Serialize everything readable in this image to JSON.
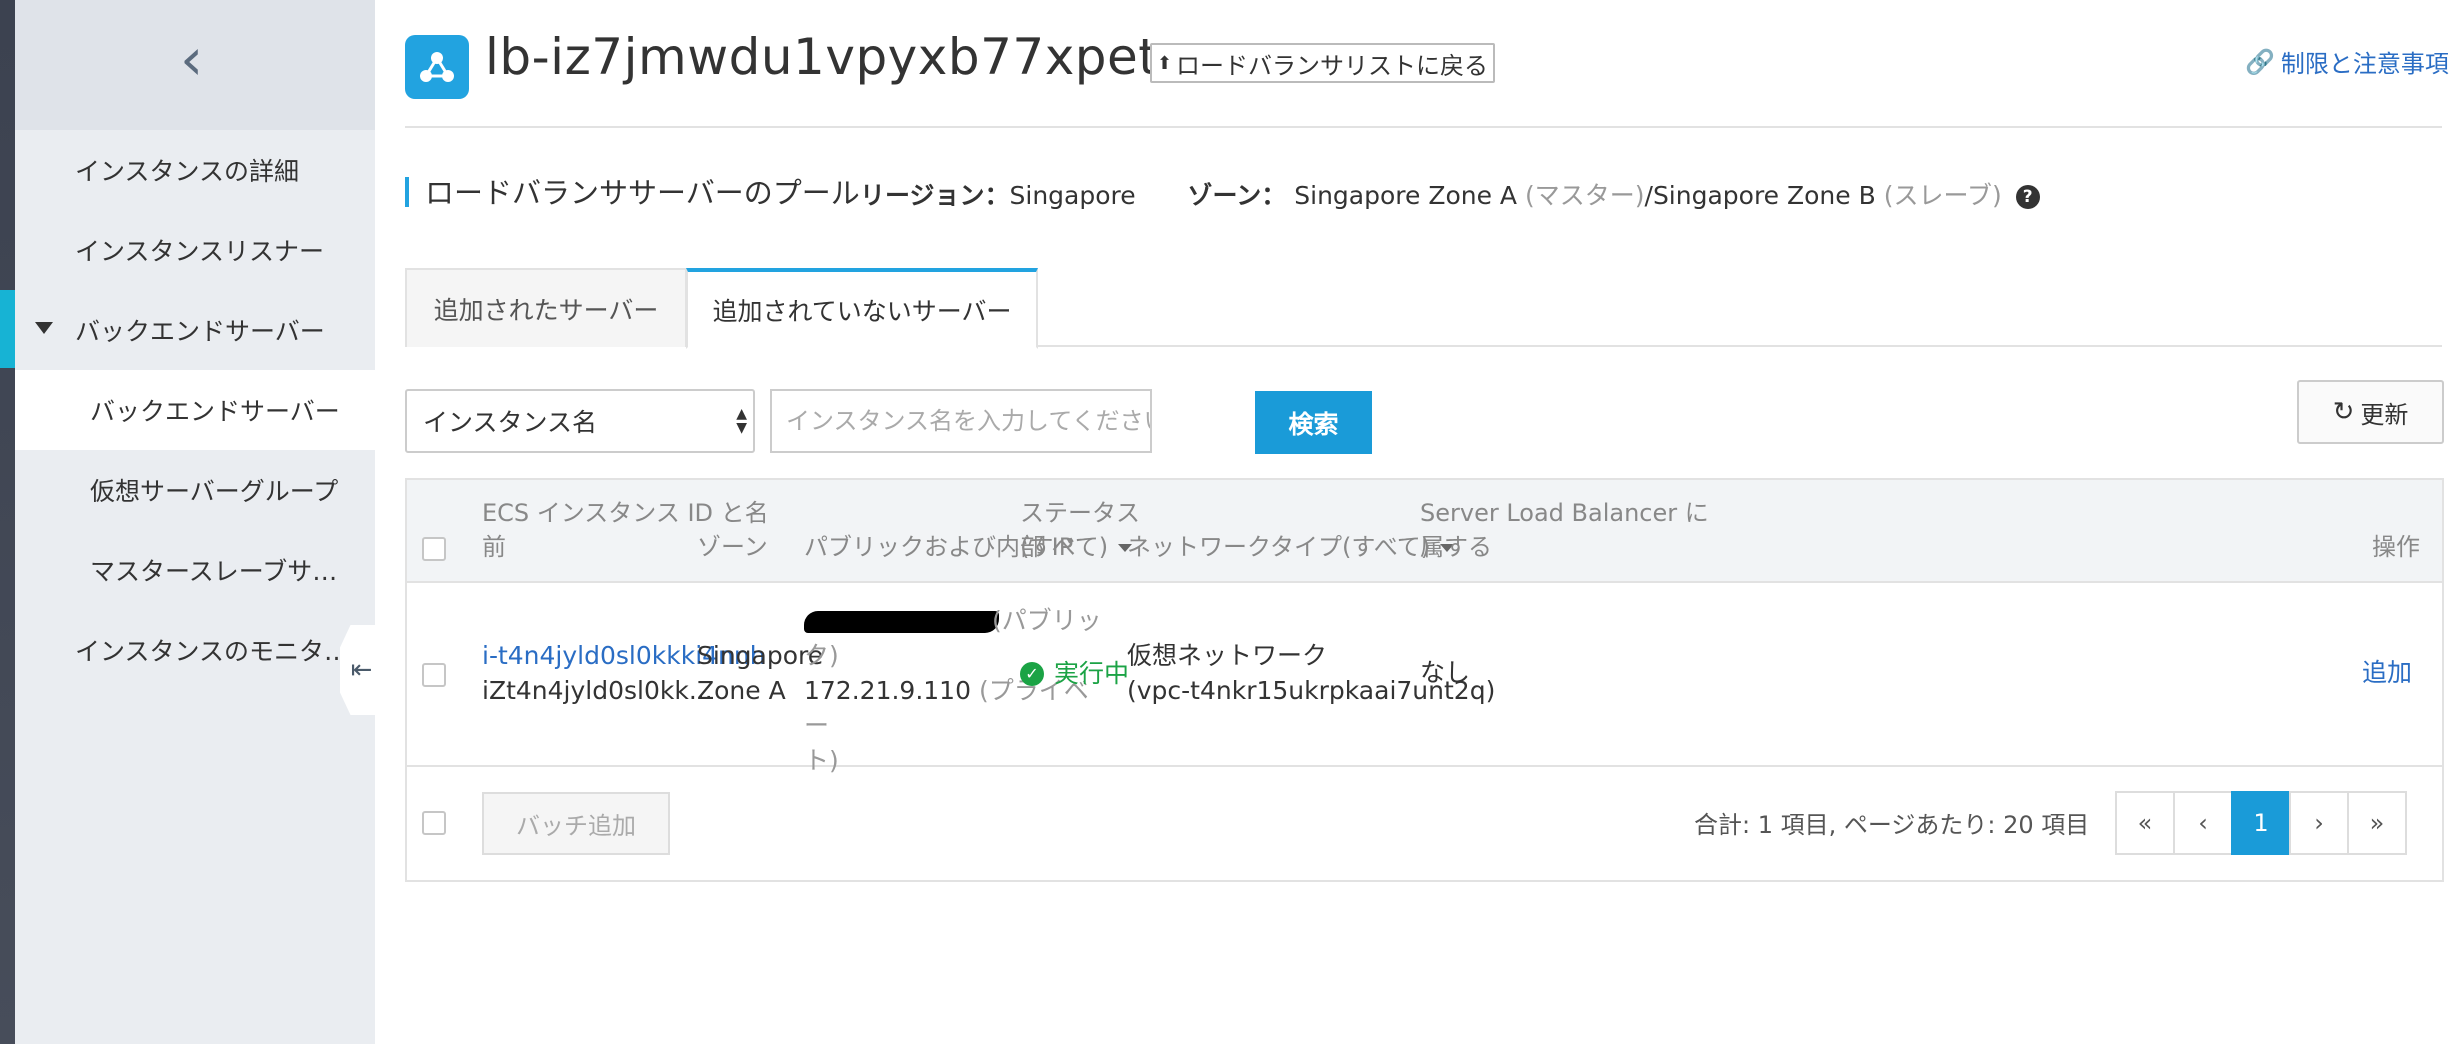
{
  "sidebar": {
    "items": [
      {
        "label": "インスタンスの詳細"
      },
      {
        "label": "インスタンスリスナー"
      },
      {
        "label": "バックエンドサーバー"
      },
      {
        "label": "バックエンドサーバー"
      },
      {
        "label": "仮想サーバーグループ"
      },
      {
        "label": "マスタースレーブサ…"
      },
      {
        "label": "インスタンスのモニタ…"
      }
    ]
  },
  "header": {
    "title": "lb-iz7jmwdu1vpyxb77xpetc",
    "back_label": "ロードバランサリストに戻る",
    "limits_label": "制限と注意事項"
  },
  "section": {
    "title": "ロードバランササーバーのプール",
    "region_label": "リージョン：",
    "region_value": "Singapore",
    "zone_label": "ゾーン：",
    "zone_a": "Singapore Zone A",
    "zone_a_role": "(マスター)",
    "zone_b": "/Singapore Zone B",
    "zone_b_role": "(スレーブ)"
  },
  "tabs": [
    {
      "label": "追加されたサーバー"
    },
    {
      "label": "追加されていないサーバー"
    }
  ],
  "filter": {
    "select_value": "インスタンス名",
    "search_placeholder": "インスタンス名を入力してください",
    "search_button": "検索",
    "refresh_button": "更新"
  },
  "table": {
    "headers": {
      "id": [
        "ECS インスタンス ID と名",
        "前"
      ],
      "zone": "ゾーン",
      "ip": "パブリックおよび内部 IP",
      "status": [
        "ステータス",
        "(すべて)"
      ],
      "network": "ネットワークタイプ(すべて)",
      "slb": [
        "Server Load Balancer に",
        "属する"
      ],
      "action": "操作"
    },
    "rows": [
      {
        "id": "i-t4n4jyld0sl0kkki4nnh",
        "name": "iZt4n4jyld0sl0kk...",
        "zone": [
          "Singapore",
          "Zone A"
        ],
        "public_tag": "(パブリッ",
        "public_tag2": "ク)",
        "private_ip": "172.21.9.110",
        "private_tag": "(プライベー",
        "private_tag2": "ト)",
        "status": "実行中",
        "network": "仮想ネットワーク",
        "vpc": "(vpc-t4nkr15ukrpkaai7unt2q)",
        "slb": "なし",
        "action": "追加"
      }
    ]
  },
  "footer": {
    "batch_add": "バッチ追加",
    "total": "合計: 1 項目, ページあたり: 20 項目",
    "pager": [
      "«",
      "‹",
      "1",
      "›",
      "»"
    ]
  },
  "colors": {
    "accent": "#1a9bd8",
    "link": "#2a6dc4",
    "running": "#1ba345",
    "sidebar_bg": "#eaedf1"
  }
}
